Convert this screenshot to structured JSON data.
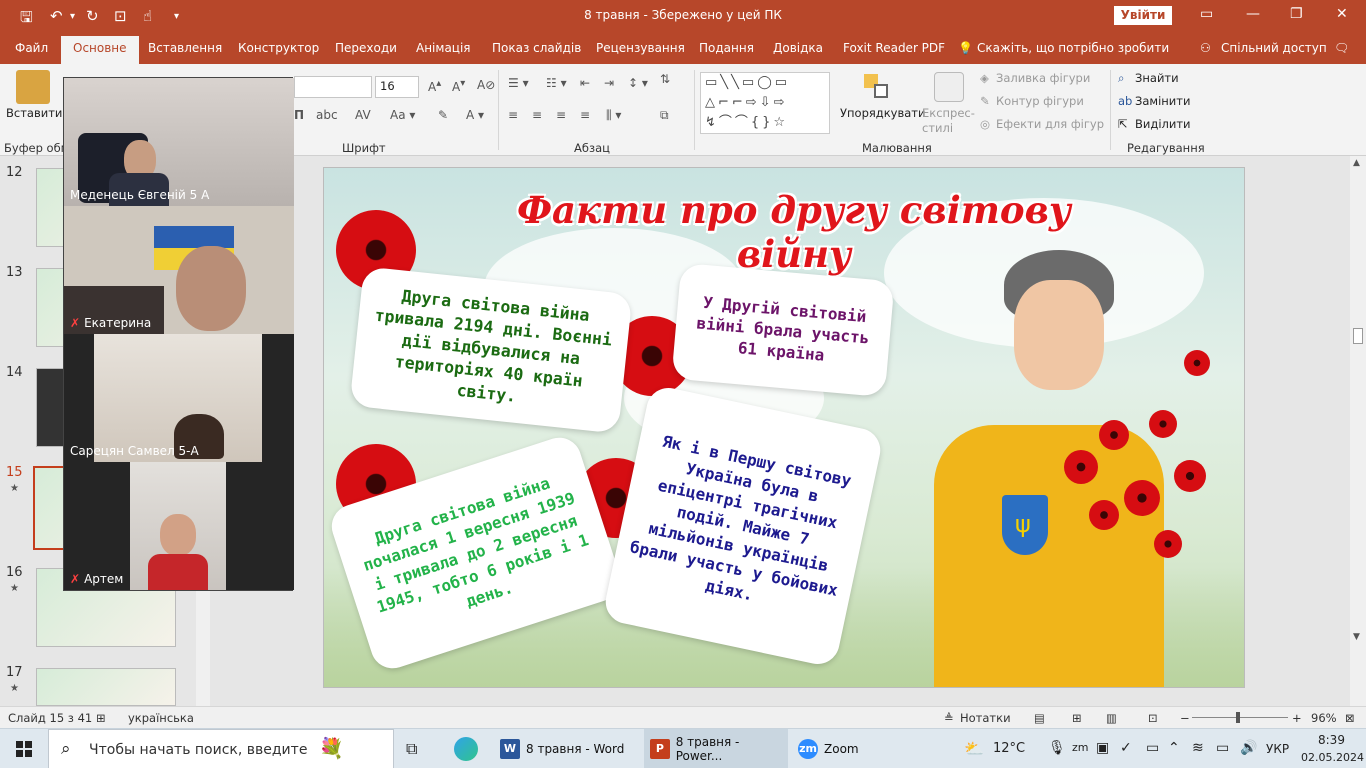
{
  "window": {
    "title": "8 травня  -  Збережено у цей ПК",
    "signin": "Увійти"
  },
  "tabs": [
    "Файл",
    "Основне",
    "Вставлення",
    "Конструктор",
    "Переходи",
    "Анімація",
    "Показ слайдів",
    "Рецензування",
    "Подання",
    "Довідка",
    "Foxit Reader PDF"
  ],
  "tell_me": "Скажіть, що потрібно зробити",
  "share": "Спільний доступ",
  "ribbon": {
    "paste": "Вставити",
    "clipboard_group": "Буфер обм",
    "font_size": "16",
    "font_group": "Шрифт",
    "paragraph_group": "Абзац",
    "arrange": "Упорядкувати",
    "quick_styles": "Експрес-стилі",
    "shape_fill": "Заливка фігури",
    "shape_outline": "Контур фігури",
    "shape_effects": "Ефекти для фігур",
    "drawing_group": "Малювання",
    "find": "Знайти",
    "replace": "Замінити",
    "select": "Виділити",
    "editing_group": "Редагування"
  },
  "slides_panel": [
    {
      "num": "12",
      "star": ""
    },
    {
      "num": "13",
      "star": ""
    },
    {
      "num": "14",
      "star": ""
    },
    {
      "num": "15",
      "star": "★"
    },
    {
      "num": "16",
      "star": "★"
    },
    {
      "num": "17",
      "star": "★"
    }
  ],
  "slide": {
    "title": "Факти про другу світову війну",
    "card1": "Друга світова війна тривала 2194 дні. Воєнні дії відбувалися на територіях 40 країн світу.",
    "card2": "У Другій світовій війні брала участь 61 країна",
    "card3": "Друга світова війна почалася 1 вересня 1939 і тривала до 2 вересня 1945, тобто 6 років і 1 день.",
    "card4": "Як і в Першу світову Україна була в епіцентрі трагічних подій. Майже 7 мільйонів українців брали участь у бойових діях.",
    "colors": {
      "title": "#e0151b",
      "card1": "#1b6b12",
      "card2": "#6c1469",
      "card3": "#23b34a",
      "card4": "#1d1a8f"
    }
  },
  "zoom_participants": [
    {
      "name": "Меденець Євгеній 5 А",
      "muted": false
    },
    {
      "name": "Екатерина",
      "muted": true
    },
    {
      "name": "Сарецян Самвел 5-А",
      "muted": false
    },
    {
      "name": "Артем",
      "muted": true
    }
  ],
  "statusbar": {
    "slide_info": "Слайд 15 з 41",
    "language": "українська",
    "notes": "Нотатки",
    "zoom": "96%"
  },
  "taskbar": {
    "search": "Чтобы начать поиск, введите",
    "app_word": "8 травня - Word",
    "app_ppt": "8 травня - Power...",
    "app_zoom": "Zoom",
    "weather": "12°C",
    "lang": "УКР",
    "time": "8:39",
    "date": "02.05.2024"
  }
}
